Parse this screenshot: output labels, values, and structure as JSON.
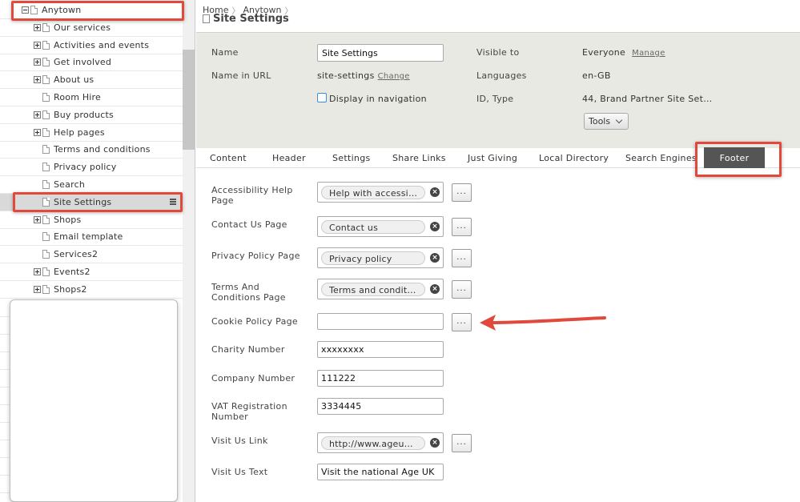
{
  "sidebar": {
    "items": [
      {
        "label": "Anytown",
        "toggle": "minus"
      },
      {
        "label": "Our services",
        "toggle": "plus"
      },
      {
        "label": "Activities and events",
        "toggle": "plus"
      },
      {
        "label": "Get involved",
        "toggle": "plus"
      },
      {
        "label": "About us",
        "toggle": "plus"
      },
      {
        "label": "Room Hire",
        "toggle": "none"
      },
      {
        "label": "Buy products",
        "toggle": "plus"
      },
      {
        "label": "Help pages",
        "toggle": "plus"
      },
      {
        "label": "Terms and conditions",
        "toggle": "none"
      },
      {
        "label": "Privacy policy",
        "toggle": "none"
      },
      {
        "label": "Search",
        "toggle": "none"
      },
      {
        "label": "Site Settings",
        "toggle": "none",
        "selected": true
      },
      {
        "label": "Shops",
        "toggle": "plus"
      },
      {
        "label": "Email template",
        "toggle": "none"
      },
      {
        "label": "Services2",
        "toggle": "none"
      },
      {
        "label": "Events2",
        "toggle": "plus"
      },
      {
        "label": "Shops2",
        "toggle": "plus"
      }
    ]
  },
  "breadcrumb": {
    "home": "Home",
    "anytown": "Anytown"
  },
  "page_title": "Site Settings",
  "properties": {
    "name_label": "Name",
    "name_value": "Site Settings",
    "url_label": "Name in URL",
    "url_value": "site-settings",
    "url_change": "Change",
    "display_nav": "Display in navigation",
    "visible_label": "Visible to",
    "visible_value": "Everyone",
    "visible_manage": "Manage",
    "languages_label": "Languages",
    "languages_value": "en-GB",
    "id_label": "ID, Type",
    "id_value": "44, Brand Partner Site Set…",
    "tools": "Tools"
  },
  "tabs": [
    "Content",
    "Header",
    "Settings",
    "Share Links",
    "Just Giving",
    "Local Directory",
    "Search Engines",
    "Footer"
  ],
  "footer_form": {
    "accessibility_label": "Accessibility Help Page",
    "accessibility_value": "Help with accessibi…",
    "contact_label": "Contact Us Page",
    "contact_value": "Contact us",
    "privacy_label": "Privacy Policy Page",
    "privacy_value": "Privacy policy",
    "terms_label": "Terms And Conditions Page",
    "terms_value": "Terms and conditi…",
    "cookie_label": "Cookie Policy Page",
    "cookie_value": "",
    "charity_label": "Charity Number",
    "charity_value": "xxxxxxxx",
    "company_label": "Company Number",
    "company_value": "111222",
    "vat_label": "VAT Registration Number",
    "vat_value": "3334445",
    "visit_link_label": "Visit Us Link",
    "visit_link_value": "http://www.ageuk.…",
    "visit_text_label": "Visit Us Text",
    "visit_text_value": "Visit the national Age UK",
    "browse": "..."
  },
  "colors": {
    "highlight": "#e0493c",
    "active_tab": "#555555",
    "panel_bg": "#e9e9e3"
  }
}
